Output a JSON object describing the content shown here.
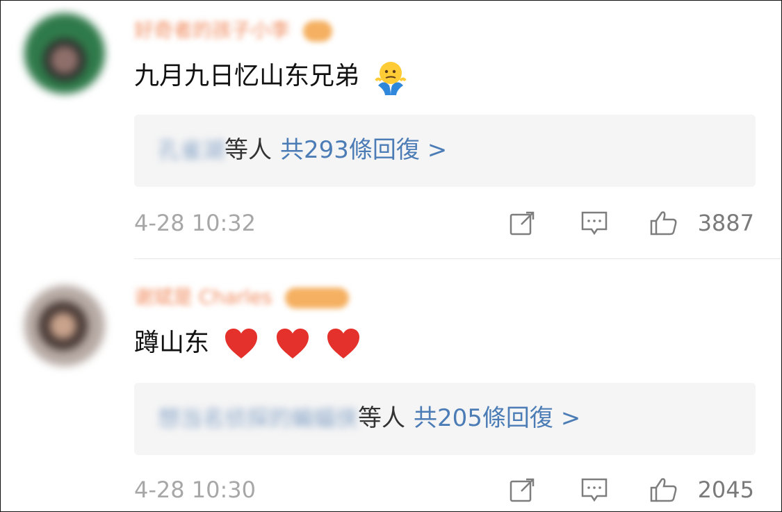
{
  "comments": [
    {
      "username": "好奇者的孩子小李",
      "text": "九月九日忆山东兄弟",
      "reply_preview": {
        "replier": "孔雀湖",
        "suffix": "等人",
        "link": "共293條回復 >"
      },
      "timestamp": "4-28 10:32",
      "likes": "3887",
      "emoji": "shrug-icon"
    },
    {
      "username": "谢斌是 Charles",
      "text": "蹲山东",
      "reply_preview": {
        "replier": "想当名侦探的蝙蝠侠",
        "suffix": "等人",
        "link": "共205條回復 >"
      },
      "timestamp": "4-28 10:30",
      "likes": "2045",
      "emoji": "heart-icon"
    }
  ],
  "colors": {
    "background": "#ffffff",
    "reply_box": "#f5f5f5",
    "link": "#4b7cb6",
    "timestamp": "#a7a7a7",
    "username": "#f08a5d"
  }
}
